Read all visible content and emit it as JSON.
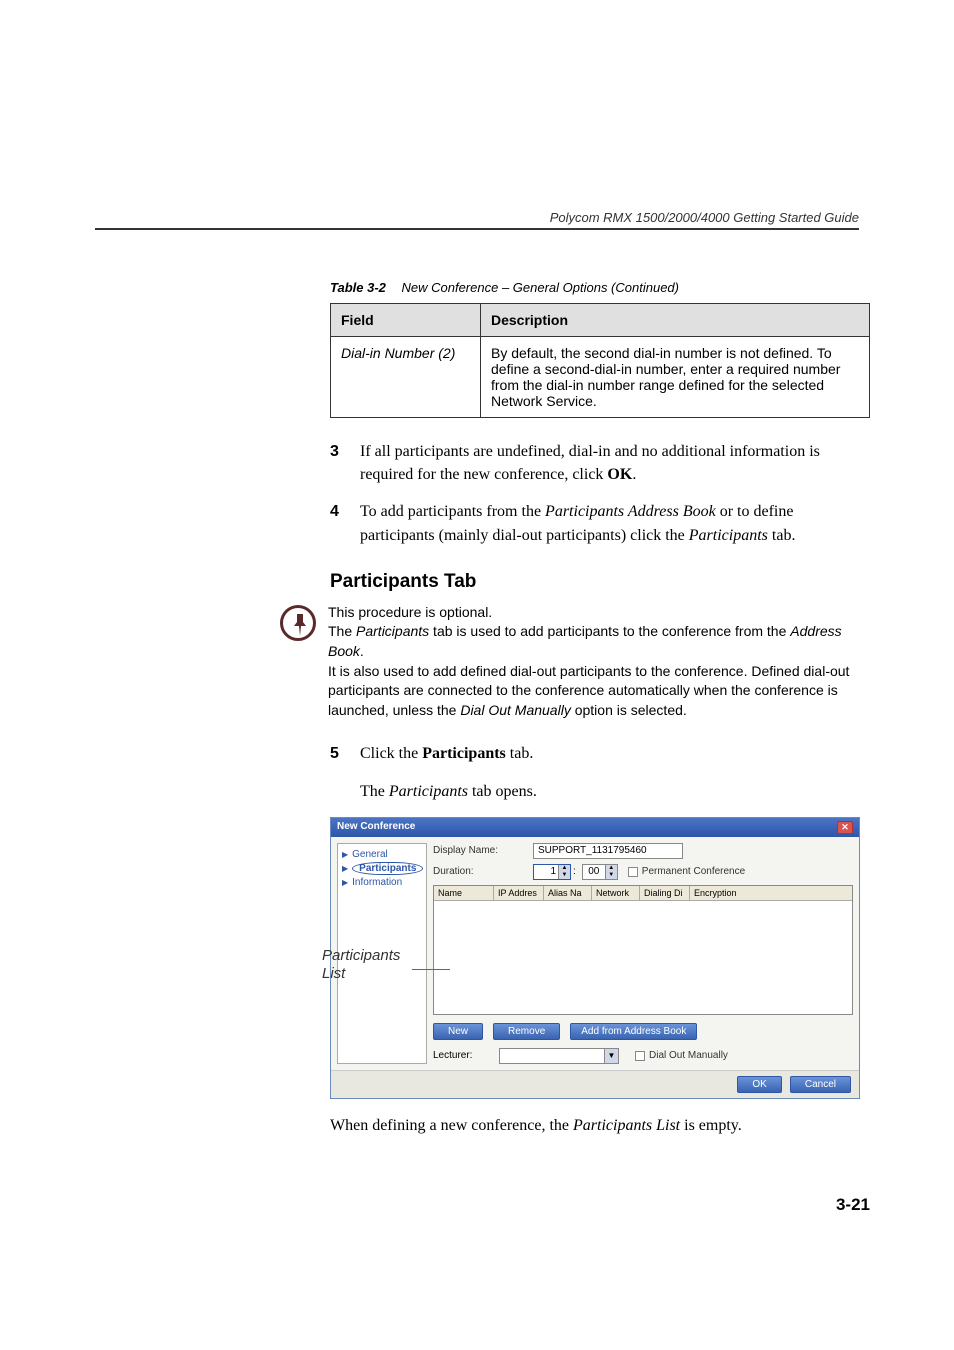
{
  "header": {
    "running": "Polycom RMX 1500/2000/4000 Getting Started Guide"
  },
  "table": {
    "caption_label": "Table 3-2",
    "caption_title": "New Conference – General Options (Continued)",
    "head_field": "Field",
    "head_desc": "Description",
    "field": "Dial-in Number (2)",
    "desc": "By default, the second dial-in number is not defined. To define a second-dial-in number, enter a required number from the dial-in number range defined for the selected Network Service."
  },
  "steps": {
    "s3_num": "3",
    "s3_a": "If all participants are undefined, dial-in and no additional information is required for the new conference, click ",
    "s3_b": "OK",
    "s3_c": ".",
    "s4_num": "4",
    "s4_a": "To add participants from the ",
    "s4_b": "Participants Address Book",
    "s4_c": " or to define participants (mainly dial-out participants) click the ",
    "s4_d": "Participants",
    "s4_e": " tab.",
    "s5_num": "5",
    "s5_a": "Click the ",
    "s5_b": "Participants",
    "s5_c": " tab.",
    "s5_open_a": "The ",
    "s5_open_b": "Participants",
    "s5_open_c": " tab opens."
  },
  "section": {
    "title": "Participants Tab"
  },
  "note": {
    "l1": "This procedure is optional.",
    "l2a": "The ",
    "l2b": "Participants",
    "l2c": " tab is used to add participants to the conference from the ",
    "l2d": "Address Book",
    "l2e": ".",
    "l3a": "It is also used to add defined dial-out participants to the conference. Defined dial-out participants are connected to the conference automatically when the conference is launched, unless the ",
    "l3b": "Dial Out Manually",
    "l3c": " option is selected."
  },
  "callout": {
    "line1": "Participants",
    "line2": "List"
  },
  "dialog": {
    "title": "New Conference",
    "nav": {
      "general": "General",
      "participants": "Participants",
      "information": "Information"
    },
    "labels": {
      "display_name": "Display Name:",
      "duration": "Duration:",
      "permanent": "Permanent Conference",
      "lecturer": "Lecturer:",
      "dial_out": "Dial Out Manually"
    },
    "values": {
      "display_name": "SUPPORT_1131795460",
      "hh": "1",
      "sep": ":",
      "mm": "00"
    },
    "grid_cols": [
      "Name",
      "IP Addres",
      "Alias Na",
      "Network",
      "Dialing Di",
      "Encryption"
    ],
    "buttons": {
      "new": "New",
      "remove": "Remove",
      "add_ab": "Add from Address Book",
      "ok": "OK",
      "cancel": "Cancel"
    }
  },
  "after": {
    "a": "When defining a new conference, the ",
    "b": "Participants List",
    "c": " is empty."
  },
  "footer": {
    "page": "3-21"
  }
}
